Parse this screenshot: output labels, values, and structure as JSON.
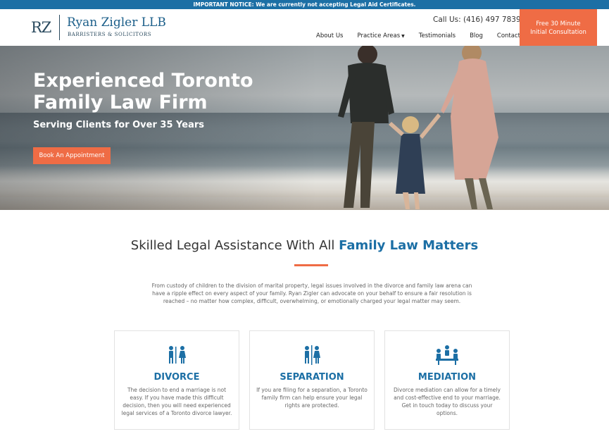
{
  "notice": "IMPORTANT NOTICE: We are currently not accepting Legal Aid Certificates.",
  "logo": {
    "mark": "RZ",
    "name": "Ryan Zigler LLB",
    "tagline": "BARRISTERS & SOLICITORS"
  },
  "header": {
    "phone": "Call Us: (416) 497 7839",
    "nav": [
      {
        "label": "About Us"
      },
      {
        "label": "Practice Areas"
      },
      {
        "label": "Testimonials"
      },
      {
        "label": "Blog"
      },
      {
        "label": "Contact"
      }
    ],
    "cta_line1": "Free 30 Minute",
    "cta_line2": "Initial Consultation"
  },
  "hero": {
    "title": "Experienced Toronto Family Law Firm",
    "subtitle": "Serving Clients for Over 35 Years",
    "button": "Book An Appointment"
  },
  "section": {
    "title_plain": "Skilled Legal Assistance With All",
    "title_accent": "Family Law Matters",
    "intro": "From custody of children to the division of marital property, legal issues involved in the divorce and family law arena can have a ripple effect on every aspect of your family. Ryan Zigler can advocate on your behalf to ensure a fair resolution is reached – no matter how complex, difficult, overwhelming, or emotionally charged your legal matter may seem."
  },
  "cards": [
    {
      "title": "DIVORCE",
      "icon": "divorce-icon",
      "text": "The decision to end a marriage is not easy. If you have made this difficult decision, then you will need experienced legal services of a Toronto divorce lawyer."
    },
    {
      "title": "SEPARATION",
      "icon": "separation-icon",
      "text": "If you are filing for a separation, a Toronto family firm can help ensure your legal rights are protected."
    },
    {
      "title": "MEDIATION",
      "icon": "mediation-icon",
      "text": "Divorce mediation can allow for a timely and cost-effective end to your marriage. Get in touch today to discuss your options."
    }
  ],
  "colors": {
    "brand_blue": "#1c6fa5",
    "accent_orange": "#ef6c45"
  }
}
